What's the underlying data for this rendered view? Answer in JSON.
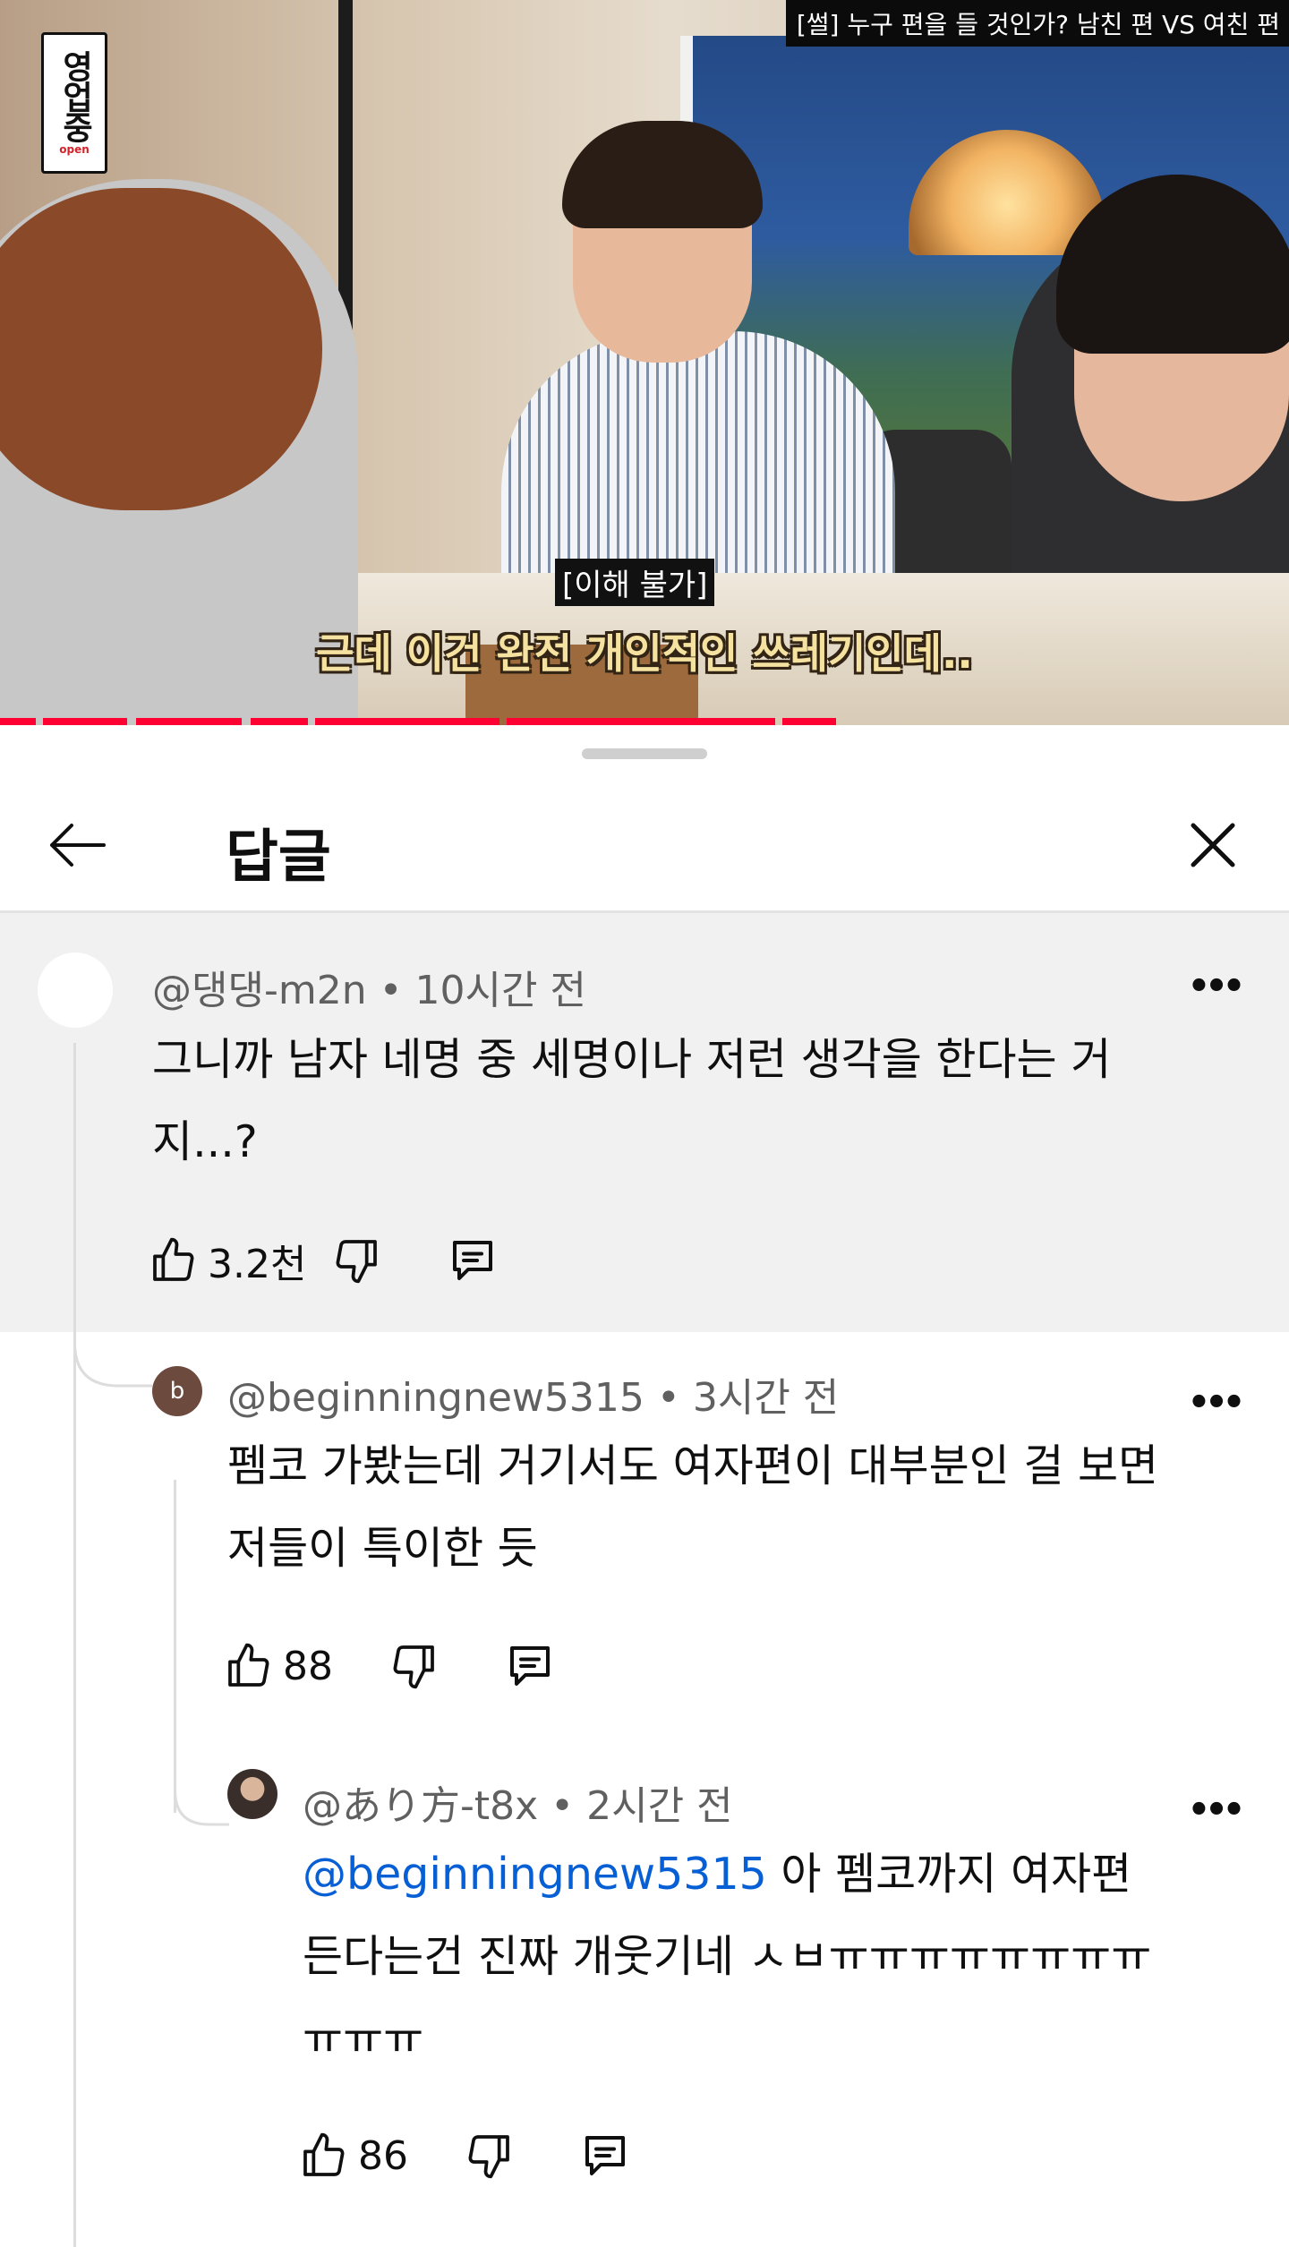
{
  "video": {
    "title_overlay": "[썰] 누구 편을 들 것인가? 남친 편 VS 여친 편",
    "channel_logo": "영업중",
    "channel_logo_sub": "open",
    "subtitle_tag": "[이해 불가]",
    "subtitle_line": "근데 이건 완전 개인적인 쓰레기인데..",
    "progress_color": "#ff0033"
  },
  "header": {
    "title": "답글",
    "back_icon": "arrow-left-icon",
    "close_icon": "close-icon"
  },
  "comments": [
    {
      "author": "@댕댕-m2n",
      "time": "10시간 전",
      "text": "그니까 남자 네명 중 세명이나 저런 생각을 한다는 거지...?",
      "likes": "3.2천",
      "highlighted": true
    },
    {
      "author": "@beginningnew5315",
      "time": "3시간 전",
      "avatar_letter": "b",
      "text": "펨코 가봤는데 거기서도 여자편이 대부분인 걸 보면 저들이 특이한 듯",
      "likes": "88"
    },
    {
      "author": "@あり方-t8x",
      "time": "2시간 전",
      "mention": "@beginningnew5315",
      "text": " 아 펨코까지 여자편 든다는건 진짜 개웃기네 ㅅㅂㅠㅠㅠㅠㅠㅠㅠㅠㅠㅠㅠ",
      "likes": "86"
    }
  ],
  "separator": "•"
}
